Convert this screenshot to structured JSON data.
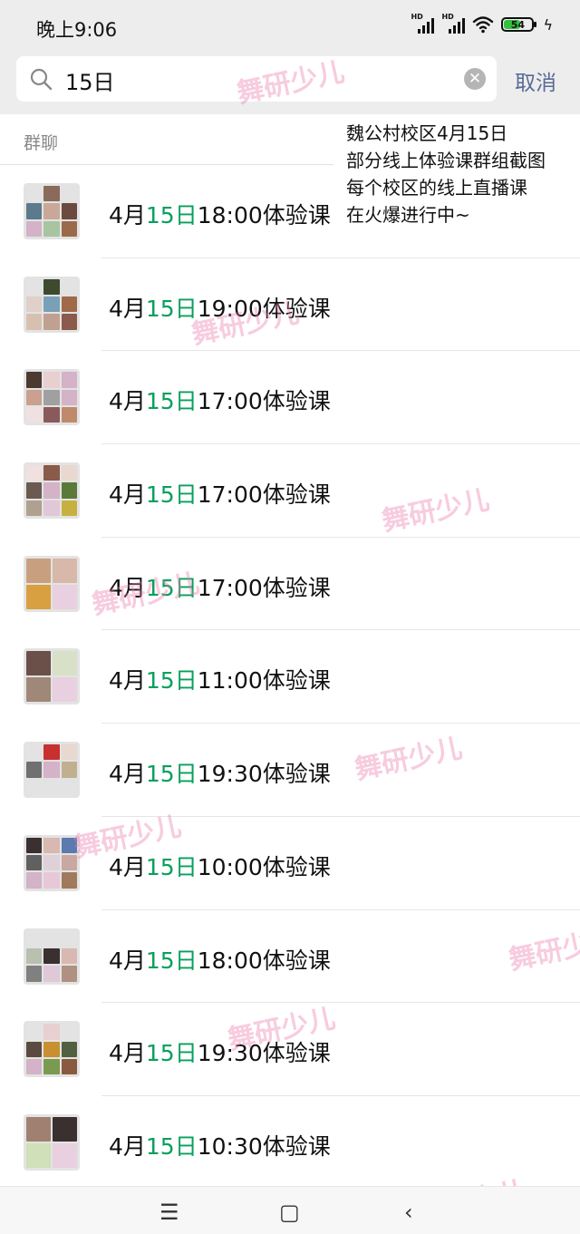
{
  "status_bar": {
    "time": "晚上9:06",
    "hd_label": "HD",
    "battery": "54"
  },
  "search": {
    "value": "15日",
    "cancel_label": "取消"
  },
  "section": {
    "label": "群聊"
  },
  "overlay": {
    "lines": [
      "魏公村校区4月15日",
      "部分线上体验课群组截图",
      "每个校区的线上直播课",
      "在火爆进行中~"
    ]
  },
  "watermark": {
    "text": "舞研少儿"
  },
  "results": [
    {
      "prefix": "4月",
      "highlight": "15日",
      "suffix": "18:00体验课"
    },
    {
      "prefix": "4月",
      "highlight": "15日",
      "suffix": "19:00体验课"
    },
    {
      "prefix": "4月",
      "highlight": "15日",
      "suffix": "17:00体验课"
    },
    {
      "prefix": "4月",
      "highlight": "15日",
      "suffix": "17:00体验课"
    },
    {
      "prefix": "4月",
      "highlight": "15日",
      "suffix": "17:00体验课"
    },
    {
      "prefix": "4月",
      "highlight": "15日",
      "suffix": "11:00体验课"
    },
    {
      "prefix": "4月",
      "highlight": "15日",
      "suffix": "19:30体验课"
    },
    {
      "prefix": "4月",
      "highlight": "15日",
      "suffix": "10:00体验课"
    },
    {
      "prefix": "4月",
      "highlight": "15日",
      "suffix": "18:00体验课"
    },
    {
      "prefix": "4月",
      "highlight": "15日",
      "suffix": "19:30体验课"
    },
    {
      "prefix": "4月",
      "highlight": "15日",
      "suffix": "10:30体验课"
    }
  ],
  "nav_bar": {
    "menu_glyph": "☰",
    "home_glyph": "▢",
    "back_glyph": "‹"
  },
  "colors": {
    "highlight": "#07a05c",
    "cancel": "#576b95",
    "header_bg": "#ededed"
  },
  "icons": [
    "search-icon",
    "clear-icon",
    "wifi-icon",
    "battery-icon",
    "signal-icon"
  ]
}
